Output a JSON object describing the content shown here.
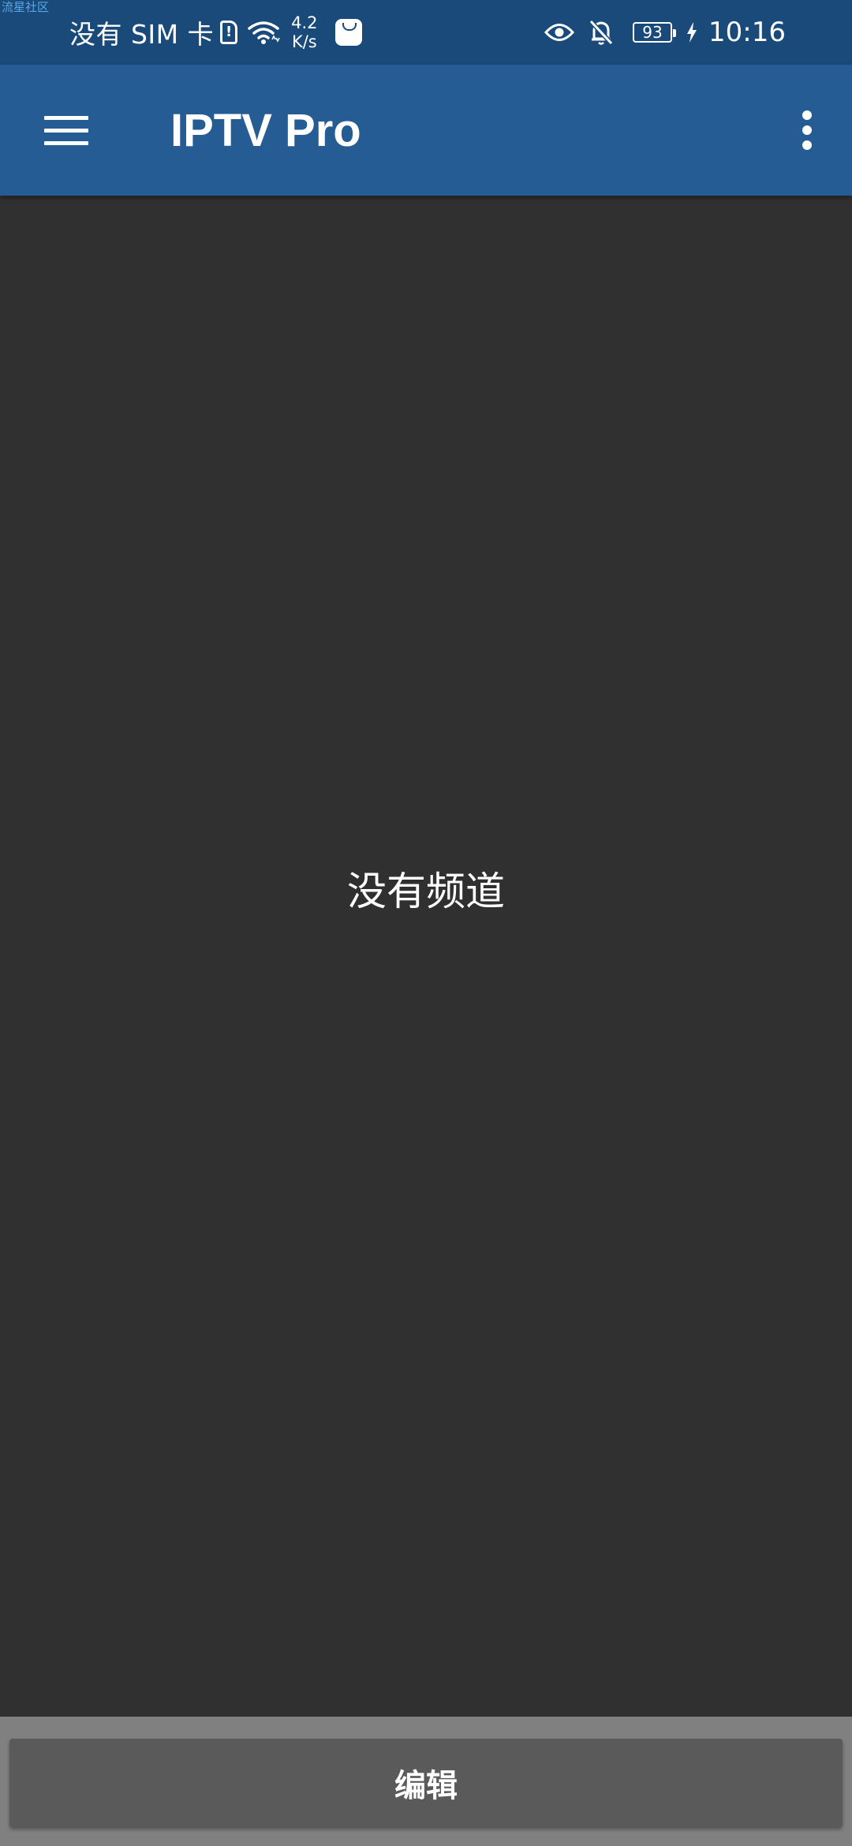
{
  "status_bar": {
    "watermark": "流星社区",
    "carrier": "没有 SIM 卡",
    "sim_icon_glyph": "!",
    "speed_value": "4.2",
    "speed_unit": "K/s",
    "battery_level": "93",
    "time": "10:16"
  },
  "app_bar": {
    "title": "IPTV Pro",
    "background_color": "#255c94"
  },
  "main": {
    "empty_message": "没有频道"
  },
  "bottom": {
    "edit_label": "编辑"
  },
  "icons": {
    "menu": "menu-icon",
    "overflow": "more-vert-icon",
    "wifi": "wifi-icon",
    "eye": "eye-icon",
    "bell_off": "bell-off-icon",
    "charging": "bolt-icon"
  }
}
